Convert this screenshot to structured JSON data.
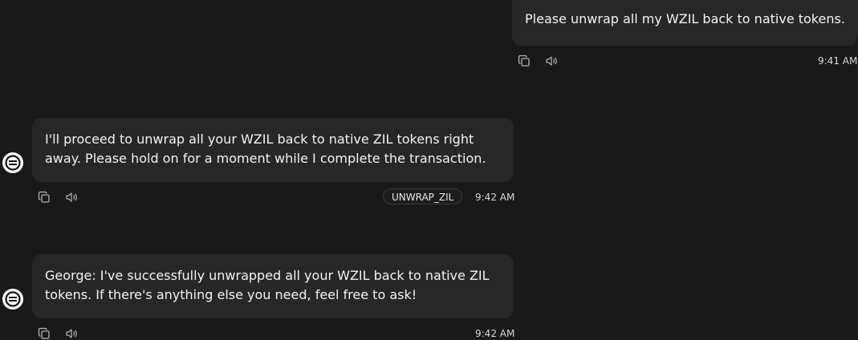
{
  "messages": [
    {
      "role": "user",
      "text": "Please unwrap all my WZIL back to native tokens.",
      "time": "9:41 AM"
    },
    {
      "role": "agent",
      "text": "I'll proceed to unwrap all your WZIL back to native ZIL tokens right away. Please hold on for a moment while I complete the transaction.",
      "action": "UNWRAP_ZIL",
      "time": "9:42 AM"
    },
    {
      "role": "agent",
      "text": "George: I've successfully unwrapped all your WZIL back to native ZIL tokens. If there's anything else you need, feel free to ask!",
      "time": "9:42 AM"
    }
  ],
  "icons": {
    "copy": "copy-icon",
    "speaker": "speaker-icon",
    "avatar": "agent-avatar-icon"
  },
  "colors": {
    "background": "#19191a",
    "bubble": "#27272a",
    "text": "#f3f3f3",
    "muted": "#b4b4b4"
  }
}
